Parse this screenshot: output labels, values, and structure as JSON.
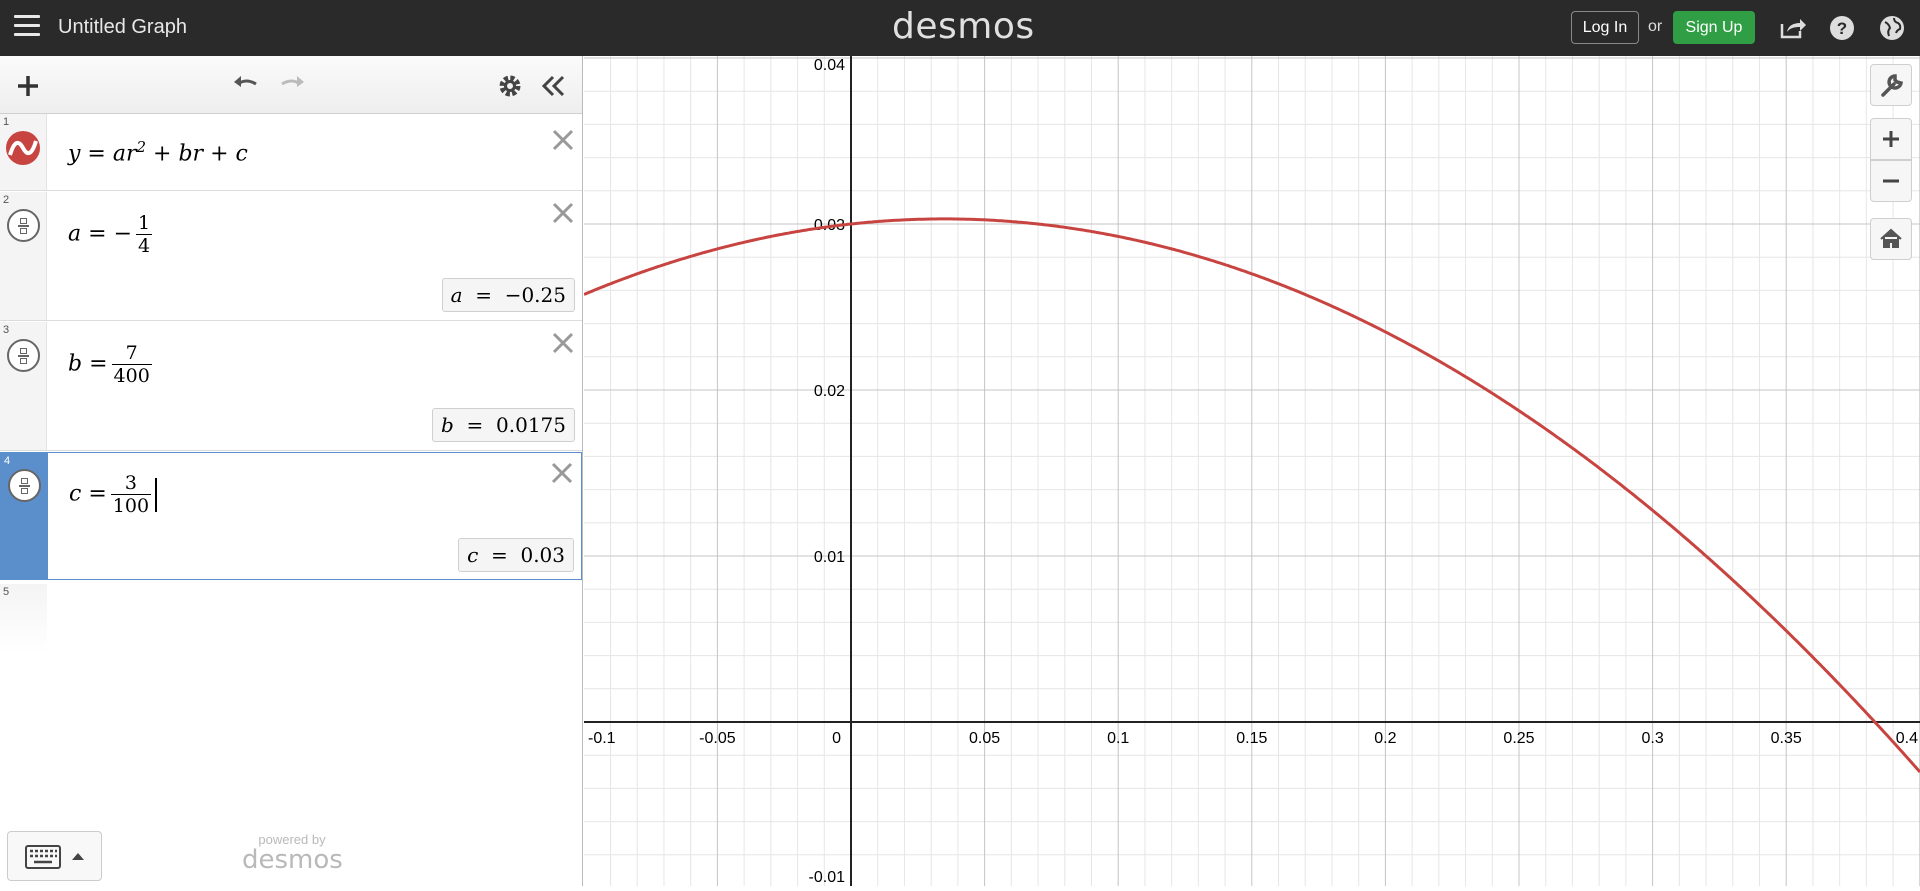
{
  "header": {
    "graph_title": "Untitled Graph",
    "brand": "desmos",
    "login_label": "Log In",
    "or_label": "or",
    "signup_label": "Sign Up"
  },
  "expressions": [
    {
      "index": "1",
      "var": "y",
      "formula_text": "y = ar^2 + br + c"
    },
    {
      "index": "2",
      "var": "a",
      "sign": "−",
      "num": "1",
      "den": "4",
      "value_var": "a",
      "value": "−0.25"
    },
    {
      "index": "3",
      "var": "b",
      "num": "7",
      "den": "400",
      "value_var": "b",
      "value": "0.0175"
    },
    {
      "index": "4",
      "var": "c",
      "num": "3",
      "den": "100",
      "value_var": "c",
      "value": "0.03"
    },
    {
      "index": "5"
    }
  ],
  "footer": {
    "powered_by": "powered by",
    "brand": "desmos"
  },
  "graph": {
    "curve_color": "#c74440",
    "x_range": [
      -0.1,
      0.4
    ],
    "y_range": [
      -0.01,
      0.04
    ],
    "x_ticks": [
      "-0.1",
      "-0.05",
      "0",
      "0.05",
      "0.1",
      "0.15",
      "0.2",
      "0.25",
      "0.3",
      "0.35",
      "0.4"
    ],
    "y_ticks": [
      "0.04",
      "0.03",
      "0.02",
      "0.01",
      "-0.01"
    ],
    "function": {
      "a": -0.25,
      "b": 0.0175,
      "c": 0.03
    }
  },
  "colors": {
    "topbar": "#2a2a2a",
    "signup": "#2f9e44",
    "active_expression": "#5b8fcc"
  }
}
